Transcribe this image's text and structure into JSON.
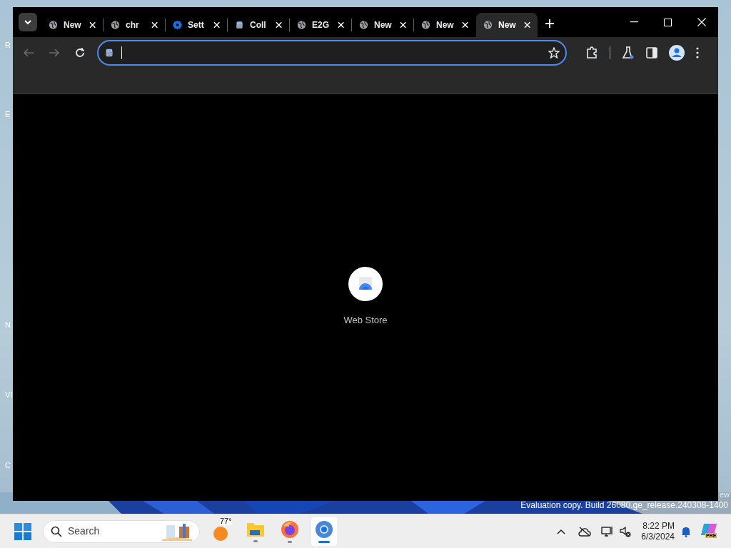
{
  "desktop": {
    "icon_labels": [
      "R",
      "E",
      "N",
      "VI",
      "C"
    ],
    "watermark": {
      "overflow": "ew",
      "text": "Evaluation copy. Build 26080.ge_release.240308-1400"
    }
  },
  "browser": {
    "tabs": [
      {
        "title": "New",
        "kind": "globe",
        "selected": false
      },
      {
        "title": "chr",
        "kind": "globe",
        "selected": false
      },
      {
        "title": "Sett",
        "kind": "gear",
        "selected": false
      },
      {
        "title": "Coll",
        "kind": "store",
        "selected": false
      },
      {
        "title": "E2G",
        "kind": "globe",
        "selected": false
      },
      {
        "title": "New",
        "kind": "globe",
        "selected": false
      },
      {
        "title": "New",
        "kind": "globe",
        "selected": false
      },
      {
        "title": "New",
        "kind": "globe",
        "selected": true
      }
    ],
    "address": {
      "focused": true
    },
    "back_disabled": true,
    "forward_disabled": true,
    "shortcut": {
      "label": "Web Store"
    }
  },
  "taskbar": {
    "search": {
      "placeholder": "Search"
    },
    "weather": {
      "temp": "77°"
    },
    "apps": [
      {
        "kind": "explorer",
        "active": false
      },
      {
        "kind": "firefox",
        "active": false
      },
      {
        "kind": "chrome",
        "active": true
      }
    ],
    "clock": {
      "time": "8:22 PM",
      "date": "6/3/2024"
    },
    "copilot_badge": "PRE"
  }
}
